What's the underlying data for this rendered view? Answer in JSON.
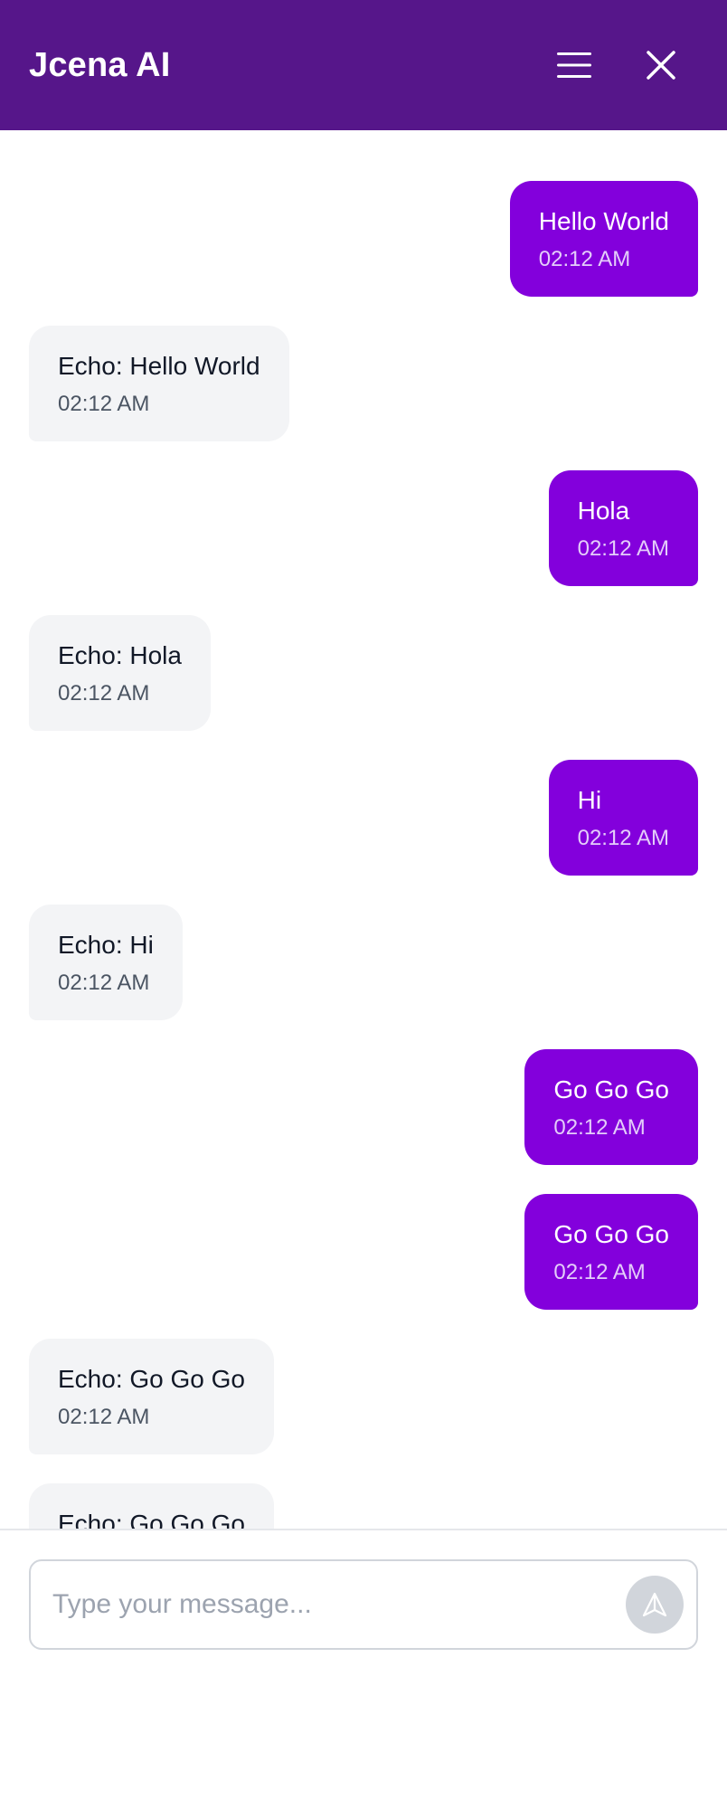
{
  "header": {
    "title": "Jcena AI",
    "menu_icon": "hamburger-menu-icon",
    "close_icon": "close-icon"
  },
  "colors": {
    "header_bg": "#56168a",
    "user_bubble": "#8300dc",
    "bot_bubble": "#f3f4f6"
  },
  "messages": [
    {
      "sender": "user",
      "text": "Hello World",
      "time": "02:12 AM"
    },
    {
      "sender": "bot",
      "text": "Echo: Hello World",
      "time": "02:12 AM"
    },
    {
      "sender": "user",
      "text": "Hola",
      "time": "02:12 AM"
    },
    {
      "sender": "bot",
      "text": "Echo: Hola",
      "time": "02:12 AM"
    },
    {
      "sender": "user",
      "text": "Hi",
      "time": "02:12 AM"
    },
    {
      "sender": "bot",
      "text": "Echo: Hi",
      "time": "02:12 AM"
    },
    {
      "sender": "user",
      "text": "Go Go Go",
      "time": "02:12 AM"
    },
    {
      "sender": "user",
      "text": "Go Go Go",
      "time": "02:12 AM"
    },
    {
      "sender": "bot",
      "text": "Echo: Go Go Go",
      "time": "02:12 AM"
    },
    {
      "sender": "bot",
      "text": "Echo: Go Go Go",
      "time": ""
    }
  ],
  "composer": {
    "placeholder": "Type your message...",
    "value": "",
    "send_icon": "send-icon"
  }
}
